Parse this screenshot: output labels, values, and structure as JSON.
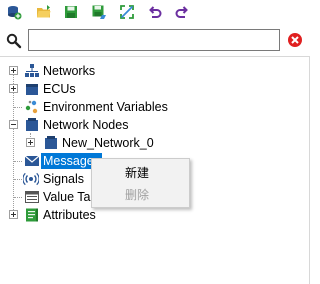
{
  "toolbar": {
    "buttons": [
      {
        "name": "add-database-icon"
      },
      {
        "name": "open-folder-icon"
      },
      {
        "name": "save-icon"
      },
      {
        "name": "save-as-icon"
      },
      {
        "name": "expand-icon"
      },
      {
        "name": "undo-icon"
      },
      {
        "name": "redo-icon"
      }
    ]
  },
  "search": {
    "value": "",
    "placeholder": ""
  },
  "tree": {
    "items": [
      {
        "label": "Networks",
        "icon": "network-icon",
        "expander": "plus"
      },
      {
        "label": "ECUs",
        "icon": "ecu-icon",
        "expander": "plus"
      },
      {
        "label": "Environment Variables",
        "icon": "env-variables-icon",
        "expander": "none"
      },
      {
        "label": "Network Nodes",
        "icon": "network-node-icon",
        "expander": "minus"
      },
      {
        "label": "New_Network_0",
        "icon": "network-node-icon",
        "expander": "plus"
      },
      {
        "label": "Messages",
        "icon": "message-icon",
        "expander": "none",
        "selected": true
      },
      {
        "label": "Signals",
        "icon": "signal-icon",
        "expander": "none"
      },
      {
        "label": "Value Tal",
        "icon": "value-table-icon",
        "expander": "none"
      },
      {
        "label": "Attributes",
        "icon": "attributes-icon",
        "expander": "plus"
      }
    ]
  },
  "context_menu": {
    "items": [
      {
        "label": "新建",
        "enabled": true
      },
      {
        "label": "删除",
        "enabled": false
      }
    ]
  },
  "colors": {
    "selection": "#0078d7",
    "icon_blue": "#2b5797",
    "icon_purple": "#6b2fa0",
    "icon_green": "#2e9b3a",
    "clear_red": "#e02020"
  }
}
